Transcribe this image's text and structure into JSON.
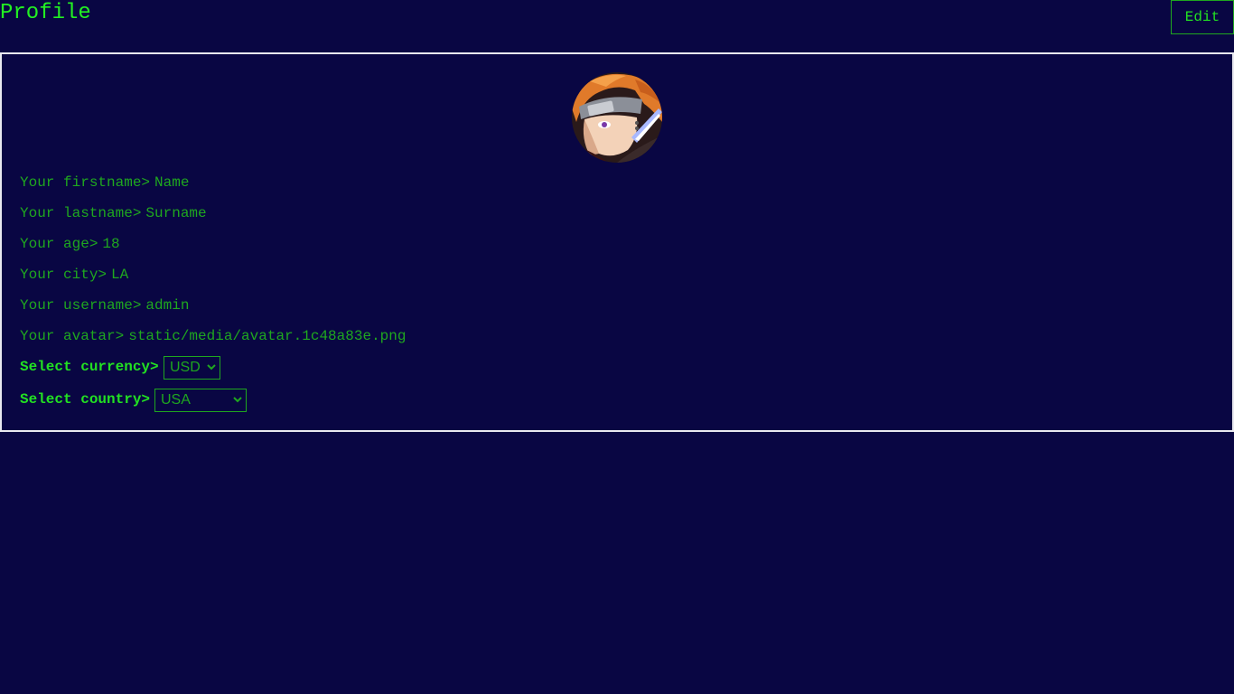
{
  "header": {
    "title": "Profile",
    "edit_label": "Edit"
  },
  "avatar": {
    "icon": "avatar-image"
  },
  "fields": {
    "firstname": {
      "label": "Your firstname>",
      "value": "Name"
    },
    "lastname": {
      "label": "Your lastname>",
      "value": "Surname"
    },
    "age": {
      "label": "Your age>",
      "value": "18"
    },
    "city": {
      "label": "Your city>",
      "value": "LA"
    },
    "username": {
      "label": "Your username>",
      "value": "admin"
    },
    "avatar": {
      "label": "Your avatar>",
      "value": "static/media/avatar.1c48a83e.png"
    }
  },
  "currency": {
    "label": "Select currency>",
    "selected": "USD"
  },
  "country": {
    "label": "Select country>",
    "selected": "USA"
  },
  "colors": {
    "background": "#090643",
    "text": "#1fa71f",
    "accent": "#22e022",
    "border": "#e9e9f0"
  }
}
